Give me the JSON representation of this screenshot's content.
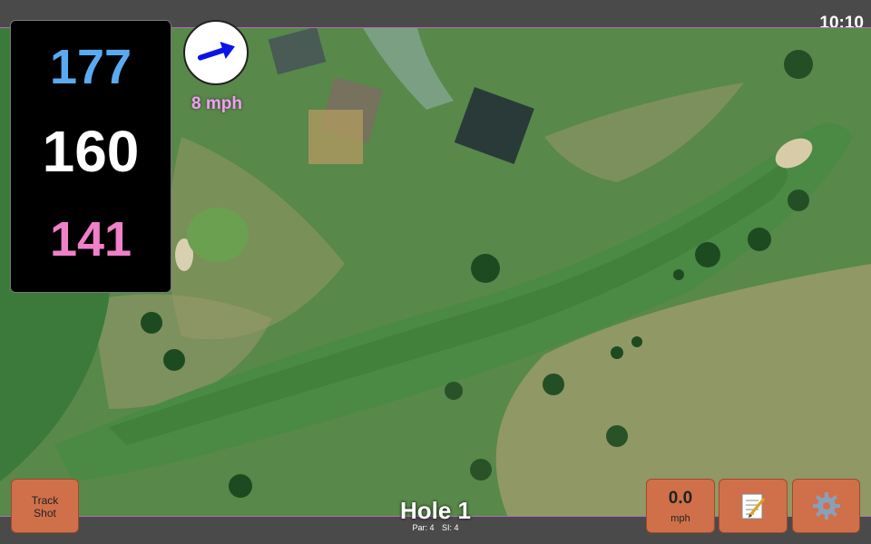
{
  "status": {
    "time": "10:10"
  },
  "distances": {
    "back": "177",
    "middle": "160",
    "front": "141"
  },
  "wind": {
    "speed": "8 mph",
    "direction_icon": "arrow-icon"
  },
  "hole": {
    "title": "Hole 1",
    "par": "Par: 4",
    "stroke_index": "SI: 4"
  },
  "buttons": {
    "track_shot": "Track\nShot",
    "speed_value": "0.0",
    "speed_unit": "mph",
    "notes_icon": "notepad-icon",
    "settings_icon": "gear-icon"
  },
  "colors": {
    "back": "#5aaaf0",
    "middle": "#ffffff",
    "front": "#f080c8",
    "wind_text": "#f0a0f0",
    "button": "#d0704a"
  }
}
